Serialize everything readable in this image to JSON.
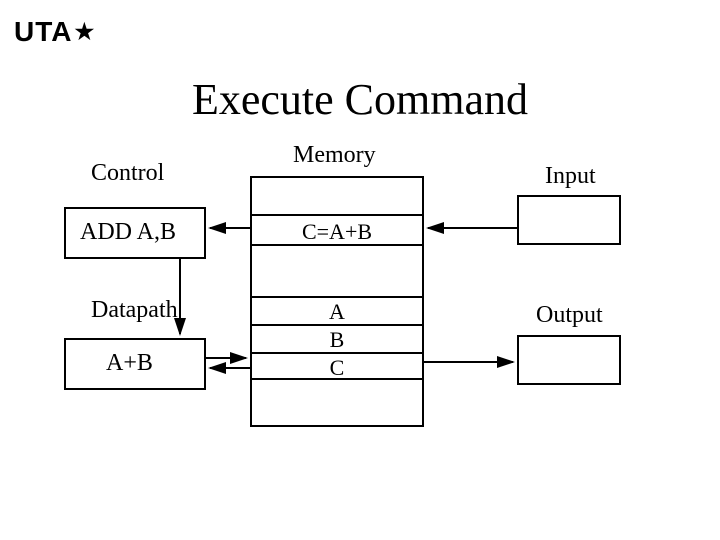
{
  "logo": {
    "text": "UTA",
    "star": "★"
  },
  "title": "Execute Command",
  "labels": {
    "control": "Control",
    "memory": "Memory",
    "input": "Input",
    "datapath": "Datapath",
    "output": "Output"
  },
  "control_box": {
    "text": "ADD A,B"
  },
  "datapath_box": {
    "text": "A+B"
  },
  "memory": {
    "instr": "C=A+B",
    "rows": {
      "a": "A",
      "b": "B",
      "c": "C"
    }
  }
}
